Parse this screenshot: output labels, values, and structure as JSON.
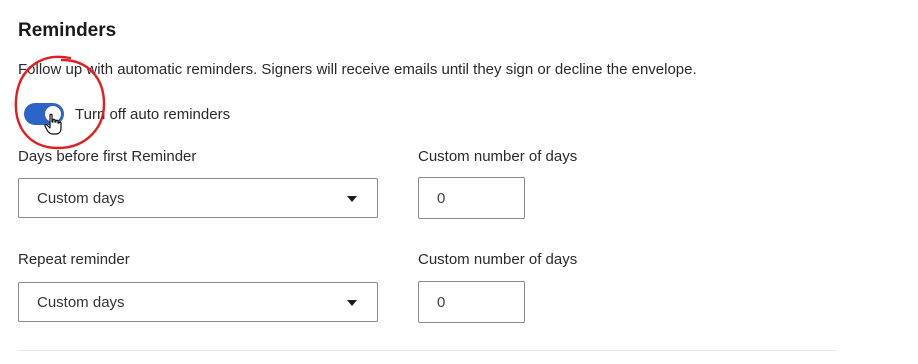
{
  "reminders": {
    "title": "Reminders",
    "description": "Follow up with automatic reminders. Signers will receive emails until they sign or decline the envelope.",
    "toggle": {
      "label": "Turn off auto reminders",
      "state": "on",
      "color": "#2d64c8"
    },
    "first_reminder": {
      "label": "Days before first Reminder",
      "selected": "Custom days"
    },
    "first_custom_days": {
      "label": "Custom number of days",
      "value": "0"
    },
    "repeat_reminder": {
      "label": "Repeat reminder",
      "selected": "Custom days"
    },
    "repeat_custom_days": {
      "label": "Custom number of days",
      "value": "0"
    }
  },
  "annotation": {
    "color": "#e02020"
  }
}
